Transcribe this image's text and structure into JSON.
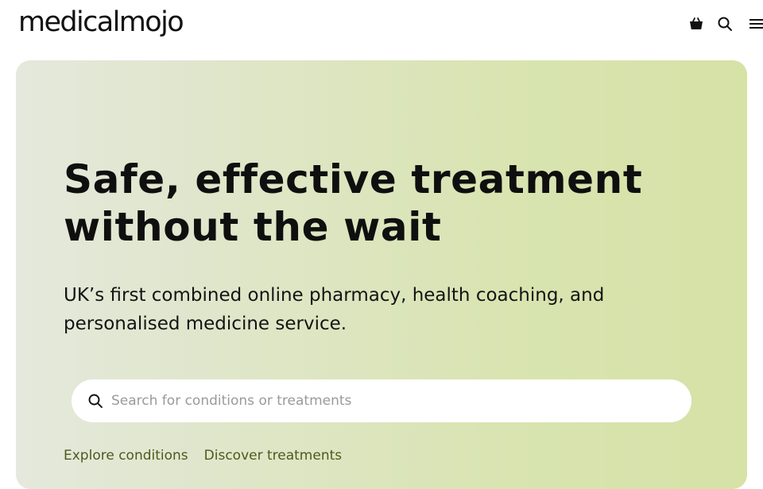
{
  "header": {
    "logo_text": "medicalmojo",
    "icons": [
      "basket-icon",
      "search-icon",
      "menu-icon"
    ]
  },
  "hero": {
    "title": "Safe, effective treatment without the wait",
    "subtitle": "UK’s first combined online pharmacy, health coaching, and personalised medicine service.",
    "search": {
      "placeholder": "Search for conditions or treatments",
      "value": ""
    },
    "links": {
      "explore": "Explore conditions",
      "discover": "Discover treatments"
    }
  },
  "colors": {
    "text": "#111111",
    "link": "#4c5a1e",
    "hero_start": "#e5e8dc",
    "hero_end": "#d6e2a6",
    "search_bg": "#ffffff"
  }
}
